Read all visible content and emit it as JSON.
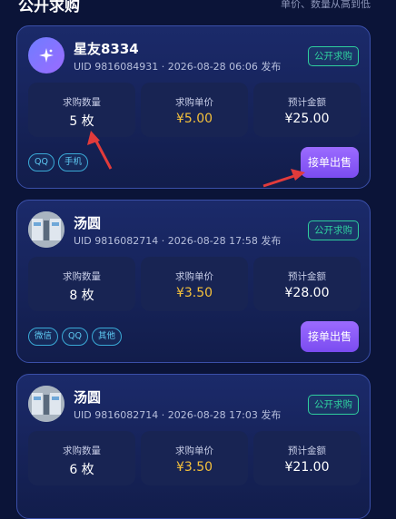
{
  "header": {
    "title": "公开求购",
    "sort_label": "单价、数量从高到低"
  },
  "colors": {
    "background": "#0b1438",
    "card_border": "#3a4fa8",
    "badge_green": "#2fcf9e",
    "price_yellow": "#f5c13b",
    "button_purple": "#8a5cf5",
    "tag_blue": "#5ec9f2",
    "annotation_red": "#e23b3b"
  },
  "cards": [
    {
      "name": "星友8334",
      "meta": "UID 9816084931 · 2026-08-28 06:06 发布",
      "badge": "公开求购",
      "quantity_label": "求购数量",
      "quantity_value": "5 枚",
      "price_label": "求购单价",
      "price_value": "¥5.00",
      "total_label": "预计金额",
      "total_value": "¥25.00",
      "tags": [
        "QQ",
        "手机"
      ],
      "button": "接单出售",
      "avatar_icon": "sparkle-icon"
    },
    {
      "name": "汤圆",
      "meta": "UID 9816082714 · 2026-08-28 17:58 发布",
      "badge": "公开求购",
      "quantity_label": "求购数量",
      "quantity_value": "8 枚",
      "price_label": "求购单价",
      "price_value": "¥3.50",
      "total_label": "预计金额",
      "total_value": "¥28.00",
      "tags": [
        "微信",
        "QQ",
        "其他"
      ],
      "button": "接单出售",
      "avatar_icon": "photo-avatar"
    },
    {
      "name": "汤圆",
      "meta": "UID 9816082714 · 2026-08-28 17:03 发布",
      "badge": "公开求购",
      "quantity_label": "求购数量",
      "quantity_value": "6 枚",
      "price_label": "求购单价",
      "price_value": "¥3.50",
      "total_label": "预计金额",
      "total_value": "¥21.00",
      "tags": [],
      "button": "接单出售",
      "avatar_icon": "photo-avatar"
    }
  ]
}
